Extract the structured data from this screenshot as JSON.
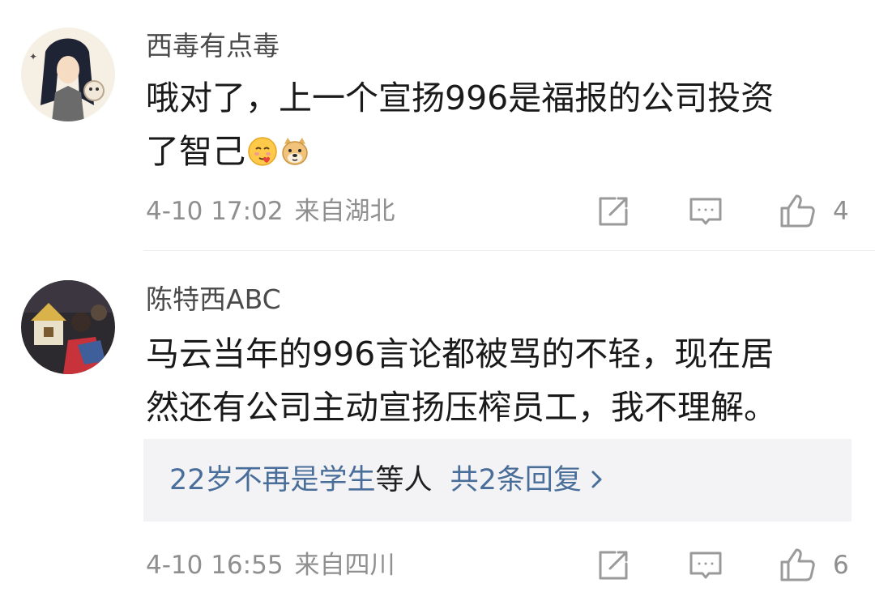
{
  "comments": [
    {
      "username": "西毒有点毒",
      "text_lines": [
        "哦对了，上一个宣扬996是福报的公司投资",
        "了智己"
      ],
      "emojis": [
        "pleading-hearts-emoji",
        "doge-emoji"
      ],
      "time": "4-10 17:02",
      "location": "来自湖北",
      "like_count": "4"
    },
    {
      "username": "陈特西ABC",
      "text_lines": [
        "马云当年的996言论都被骂的不轻，现在居",
        "然还有公司主动宣扬压榨员工，我不理解。"
      ],
      "replies_preview": {
        "user": "22岁不再是学生",
        "etc": "等人",
        "count_label": "共2条回复"
      },
      "time": "4-10 16:55",
      "location": "来自四川",
      "like_count": "6"
    }
  ],
  "colors": {
    "link": "#4a6e9a",
    "meta": "#8f8f8f",
    "icon": "#9a9a9a",
    "reply_bg": "#f3f3f5"
  },
  "icons": {
    "share": "share-icon",
    "reply": "comment-icon",
    "like": "thumbs-up-icon",
    "chevron": "chevron-right-icon"
  }
}
